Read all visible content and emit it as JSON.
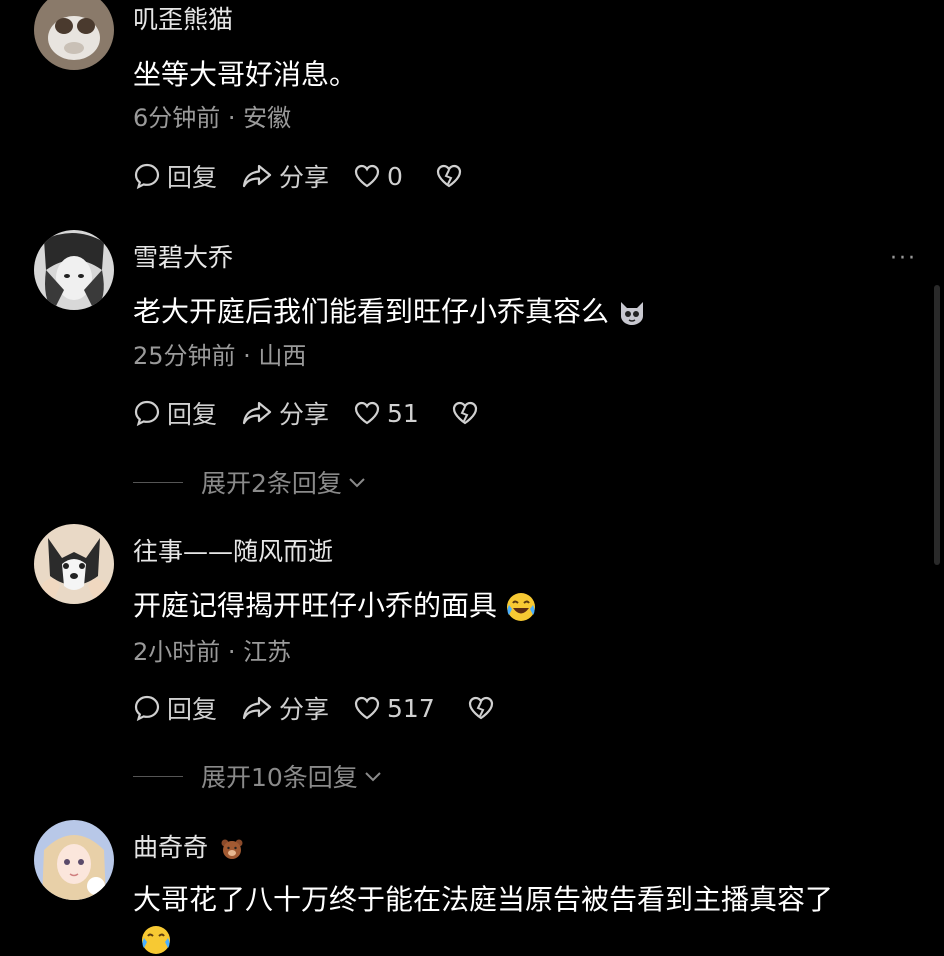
{
  "comments": [
    {
      "username": "叽歪熊猫",
      "text": "坐等大哥好消息。",
      "meta": "6分钟前 · 安徽",
      "reply": "回复",
      "share": "分享",
      "likes": "0"
    },
    {
      "username": "雪碧大乔",
      "text": "老大开庭后我们能看到旺仔小乔真容么",
      "meta": "25分钟前 · 山西",
      "reply": "回复",
      "share": "分享",
      "likes": "51",
      "expand": "展开2条回复",
      "more": "···"
    },
    {
      "username": "往事——随风而逝",
      "text": "开庭记得揭开旺仔小乔的面具",
      "meta": "2小时前 · 江苏",
      "reply": "回复",
      "share": "分享",
      "likes": "517",
      "expand": "展开10条回复"
    },
    {
      "username": "曲奇奇",
      "text": "大哥花了八十万终于能在法庭当原告被告看到主播真容了"
    }
  ],
  "colors": {
    "background": "#000000",
    "text": "#ffffff",
    "meta": "#9a9a9a"
  },
  "icons": [
    "comment-bubble-icon",
    "share-arrow-icon",
    "heart-icon",
    "broken-heart-icon",
    "chevron-down-icon",
    "more-dots-icon",
    "cat-emoji-icon",
    "laughing-crying-emoji-icon",
    "bear-emoji-icon"
  ]
}
